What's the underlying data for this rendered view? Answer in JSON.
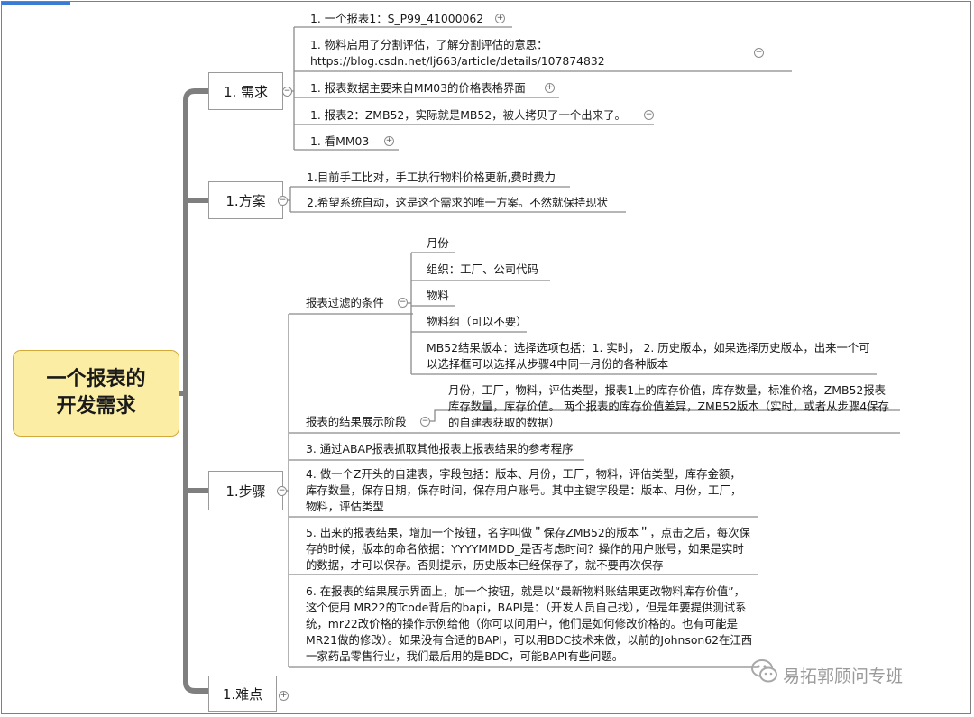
{
  "colors": {
    "root_fill": "#fbeea4",
    "root_border": "#d2a938",
    "connector": "#7f7f7f",
    "underline": "#7a7a7a",
    "text": "#1a1a1a"
  },
  "root": {
    "title": "一个报表的\n开发需求"
  },
  "branches": [
    {
      "id": "req",
      "label": "1. 需求",
      "toggle": "minus",
      "children": [
        {
          "text": "1. 一个报表1：S_P99_41000062",
          "toggle": "plus"
        },
        {
          "text": "1. 物料启用了分割评估，了解分割评估的意思：https://blog.csdn.net/lj663/article/details/107874832",
          "toggle": "minus"
        },
        {
          "text": "1. 报表数据主要来自MM03的价格表格界面",
          "toggle": "plus"
        },
        {
          "text": "1. 报表2：ZMB52，实际就是MB52，被人拷贝了一个出来了。",
          "toggle": "minus"
        },
        {
          "text": "1. 看MM03",
          "toggle": "plus"
        }
      ]
    },
    {
      "id": "plan",
      "label": "1.方案",
      "toggle": "minus",
      "children": [
        {
          "text": "1.目前手工比对，手工执行物料价格更新,费时费力"
        },
        {
          "text": "2.希望系统自动，这是这个需求的唯一方案。不然就保持现状"
        }
      ]
    },
    {
      "id": "steps",
      "label": "1.步骤",
      "toggle": "minus",
      "children": [
        {
          "text": "报表过滤的条件",
          "toggle": "minus",
          "children": [
            {
              "text": "月份"
            },
            {
              "text": "组织：工厂、公司代码"
            },
            {
              "text": "物料"
            },
            {
              "text": "物料组（可以不要）"
            },
            {
              "text": "MB52结果版本：选择选项包括：1. 实时，  2. 历史版本，如果选择历史版本，出来一个可以选择框可以选择从步骤4中同一月份的各种版本"
            }
          ]
        },
        {
          "text": "报表的结果展示阶段",
          "toggle": "minus",
          "children": [
            {
              "text": "月份，工厂，物料，评估类型，报表1上的库存价值，库存数量，标准价格，ZMB52报表库存数量，库存价值。 两个报表的库存价值差异，ZMB52版本（实时，或者从步骤4保存的自建表获取的数据）"
            }
          ]
        },
        {
          "text": "3. 通过ABAP报表抓取其他报表上报表结果的参考程序"
        },
        {
          "text": "4. 做一个Z开头的自建表，字段包括：版本、月份，工厂，物料，评估类型，库存金额，库存数量，保存日期，保存时间，保存用户账号。其中主键字段是：版本、月份，工厂，物料，评估类型"
        },
        {
          "text": "5. 出来的报表结果，增加一个按钮，名字叫做＂保存ZMB52的版本＂，点击之后，每次保存的时候，版本的命名依据：YYYYMMDD_是否考虑时间？操作的用户账号，如果是实时的数据，才可以保存。否则提示，历史版本已经保存了，就不要再次保存"
        },
        {
          "text": "6. 在报表的结果展示界面上，加一个按钮，就是以“最新物料账结果更改物料库存价值”，这个使用 MR22的Tcode背后的bapi，BAPI是：（开发人员自己找），但是年要提供测试系统，mr22改价格的操作示例给他（你可以问用户，他们是如何修改价格的。也有可能是MR21做的修改）。如果没有合适的BAPI，可以用BDC技术来做，以前的Johnson62在江西一家药品零售行业，我们最后用的是BDC，可能BAPI有些问题。"
        }
      ]
    },
    {
      "id": "diff",
      "label": "1.难点",
      "toggle": "plus",
      "children": []
    }
  ],
  "watermark": {
    "icon": "wechat-icon",
    "text": "易拓郭顾问专班"
  }
}
